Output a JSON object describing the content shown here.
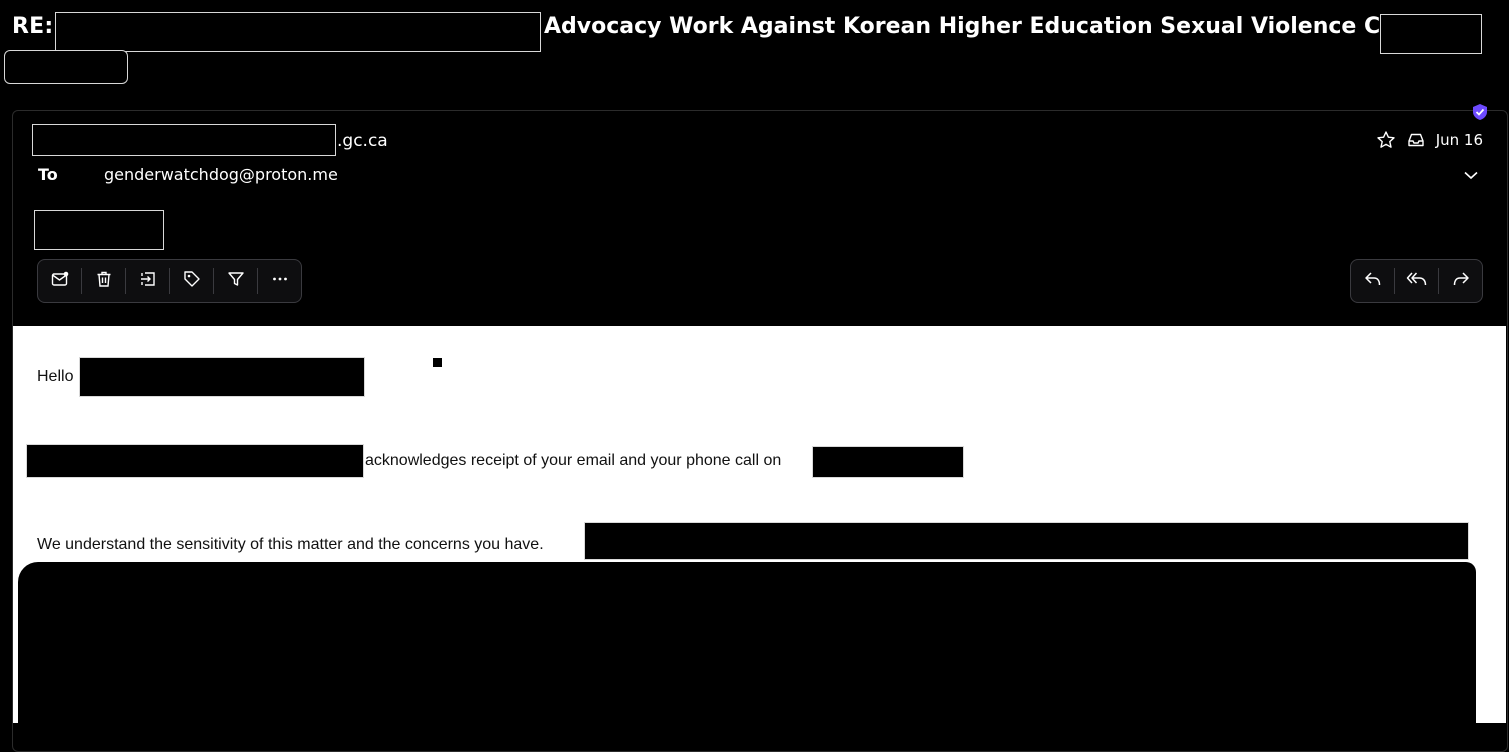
{
  "subject": {
    "prefix": "RE:",
    "text": "Advocacy Work Against Korean Higher Education Sexual Violence Crisis"
  },
  "message": {
    "sender_domain_suffix": ".gc.ca",
    "to_label": "To",
    "to_address": "genderwatchdog@proton.me",
    "date": "Jun 16",
    "icons": {
      "encryption": "shield-check-icon",
      "star": "star-icon",
      "inbox": "inbox-icon",
      "expand": "chevron-down-icon"
    }
  },
  "toolbar": {
    "actions": [
      "mark-unread-icon",
      "trash-icon",
      "move-icon",
      "label-icon",
      "filter-icon",
      "more-icon"
    ],
    "reply_actions": [
      "reply-icon",
      "reply-all-icon",
      "forward-icon"
    ]
  },
  "body": {
    "greeting": "Hello",
    "line1_suffix": "acknowledges receipt of your email and your phone call on",
    "line2": "We understand the sensitivity of this matter and the concerns you have."
  },
  "colors": {
    "background": "#000000",
    "body_background": "#ffffff",
    "accent": "#6d4aff"
  }
}
